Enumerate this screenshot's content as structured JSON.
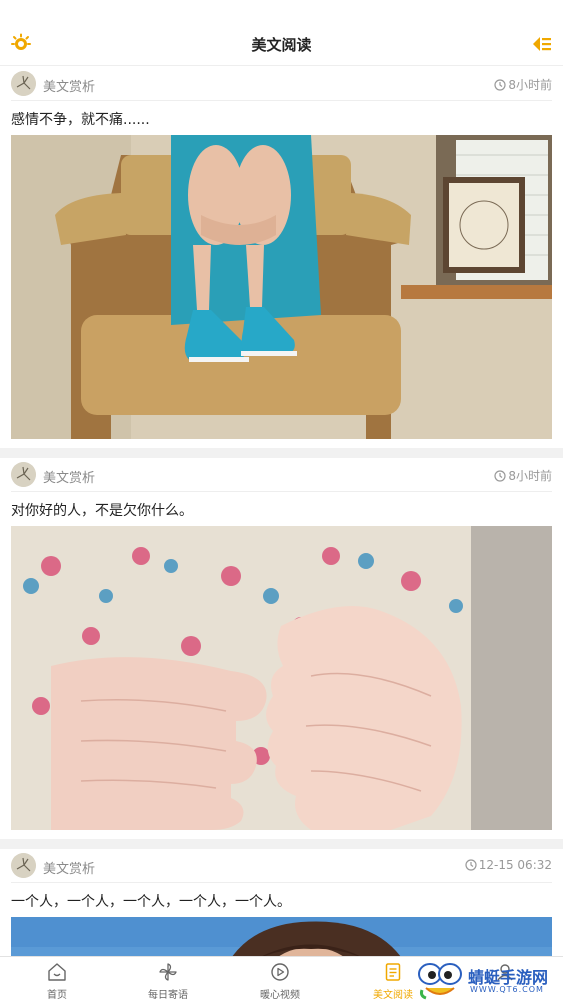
{
  "header": {
    "title": "美文阅读",
    "left_icon": "sun-gear-icon",
    "right_icon": "sort-list-icon",
    "accent": "#f0a800"
  },
  "feed": [
    {
      "source": "美文赏析",
      "time": "8小时前",
      "title": "感情不争，就不痛......",
      "image": "girl-in-chair-photo"
    },
    {
      "source": "美文赏析",
      "time": "8小时前",
      "title": "对你好的人，不是欠你什么。",
      "image": "hands-floral-dress-photo"
    },
    {
      "source": "美文赏析",
      "time": "12-15 06:32",
      "title": "一个人，一个人，一个人，一个人，一个人。",
      "image": "woman-sky-photo"
    }
  ],
  "bottom_nav": [
    {
      "label": "首页",
      "icon": "home-icon",
      "active": false
    },
    {
      "label": "每日寄语",
      "icon": "pinwheel-icon",
      "active": false
    },
    {
      "label": "暖心视频",
      "icon": "play-circle-icon",
      "active": false
    },
    {
      "label": "美文阅读",
      "icon": "document-icon",
      "active": true
    },
    {
      "label": "",
      "icon": "profile-icon",
      "active": false
    }
  ],
  "watermark": {
    "title": "蜻蜓手游网",
    "sub": "WWW.QT6.COM"
  }
}
